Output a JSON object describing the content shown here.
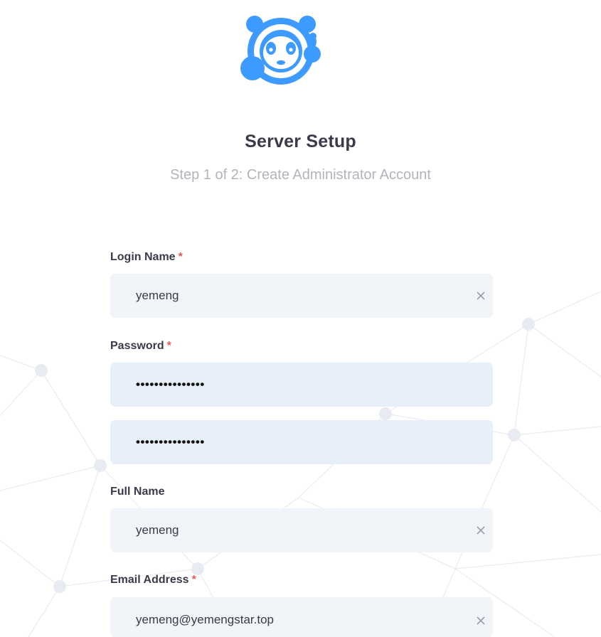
{
  "header": {
    "title": "Server Setup",
    "subtitle": "Step 1 of 2: Create Administrator Account"
  },
  "logo": {
    "icon": "panda-headset-logo",
    "color": "#3d9bff"
  },
  "form": {
    "login_name": {
      "label": "Login Name",
      "required": "*",
      "value": "yemeng"
    },
    "password": {
      "label": "Password",
      "required": "*",
      "value": "•••••••••••••••"
    },
    "password_confirm": {
      "value": "•••••••••••••••"
    },
    "full_name": {
      "label": "Full Name",
      "value": "yemeng"
    },
    "email": {
      "label": "Email Address",
      "required": "*",
      "value": "yemeng@yemengstar.top"
    },
    "clear_icon": "close-icon"
  },
  "colors": {
    "accent": "#3d9bff",
    "required": "#e45b5b",
    "input_bg": "#f1f4f8",
    "autofill_bg": "#e7effb"
  }
}
